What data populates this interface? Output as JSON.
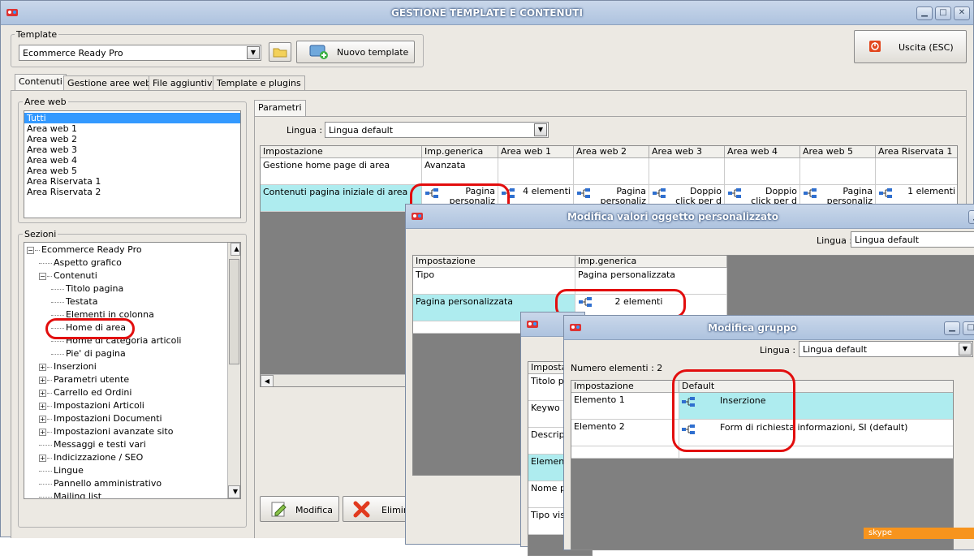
{
  "main": {
    "title": "GESTIONE TEMPLATE E CONTENUTI",
    "template_group_label": "Template",
    "template_value": "Ecommerce Ready Pro",
    "new_template_label": "Nuovo template",
    "exit_label": "Uscita (ESC)",
    "tabs": [
      "Contenuti",
      "Gestione aree web",
      "File aggiuntivi",
      "Template e plugins"
    ],
    "aree_label": "Aree web",
    "aree": [
      "Tutti",
      "Area web 1",
      "Area web 2",
      "Area web 3",
      "Area web 4",
      "Area web 5",
      "Area Riservata 1",
      "Area Riservata 2"
    ],
    "sezioni_label": "Sezioni",
    "tree": [
      {
        "t": "Ecommerce Ready Pro",
        "l": 0,
        "pm": "⊟"
      },
      {
        "t": "Aspetto grafico",
        "l": 1
      },
      {
        "t": "Contenuti",
        "l": 1,
        "pm": "⊟"
      },
      {
        "t": "Titolo pagina",
        "l": 2
      },
      {
        "t": "Testata",
        "l": 2
      },
      {
        "t": "Elementi in colonna",
        "l": 2
      },
      {
        "t": "Home di area",
        "l": 2
      },
      {
        "t": "Home di categoria articoli",
        "l": 2
      },
      {
        "t": "Pie' di pagina",
        "l": 2
      },
      {
        "t": "Inserzioni",
        "l": 1,
        "pm": "⊞"
      },
      {
        "t": "Parametri utente",
        "l": 1,
        "pm": "⊞"
      },
      {
        "t": "Carrello ed Ordini",
        "l": 1,
        "pm": "⊞"
      },
      {
        "t": "Impostazioni Articoli",
        "l": 1,
        "pm": "⊞"
      },
      {
        "t": "Impostazioni Documenti",
        "l": 1,
        "pm": "⊞"
      },
      {
        "t": "Impostazioni avanzate sito",
        "l": 1,
        "pm": "⊞"
      },
      {
        "t": "Messaggi e testi vari",
        "l": 1
      },
      {
        "t": "Indicizzazione / SEO",
        "l": 1,
        "pm": "⊞"
      },
      {
        "t": "Lingue",
        "l": 1
      },
      {
        "t": "Pannello amministrativo",
        "l": 1
      },
      {
        "t": "Mailing list",
        "l": 1
      }
    ],
    "parametri_tab": "Parametri",
    "lingua_label": "Lingua :",
    "lingua_value": "Lingua default",
    "grid_headers": [
      "Impostazione",
      "Imp.generica",
      "Area web 1",
      "Area web 2",
      "Area web 3",
      "Area web 4",
      "Area web 5",
      "Area Riservata 1"
    ],
    "row1": {
      "name": "Gestione home page di area",
      "generic": "Avanzata"
    },
    "row2": {
      "name": "Contenuti pagina iniziale di area",
      "cells": [
        "Pagina personaliz",
        "4 elementi",
        "Pagina personaliz",
        "Doppio click per d",
        "Doppio click per d",
        "Pagina personaliz",
        "1 elementi"
      ]
    },
    "modifica_label": "Modifica",
    "elimina_label": "Elimina"
  },
  "dialog1": {
    "title": "Modifica valori oggetto personalizzato",
    "lingua_label": "Lingua :",
    "lingua_value": "Lingua default",
    "headers": [
      "Impostazione",
      "Imp.generica"
    ],
    "rows": [
      [
        "Tipo",
        "Pagina personalizzata"
      ],
      [
        "Pagina personalizzata",
        "2 elementi"
      ]
    ]
  },
  "dialog2": {
    "rows": [
      "Imposta",
      "Titolo pa",
      "Keywo",
      "Descripti",
      "Elementi",
      "Nome pa",
      "Tipo visu"
    ]
  },
  "dialog3": {
    "title": "Modifica gruppo",
    "lingua_label": "Lingua :",
    "lingua_value": "Lingua default",
    "count_label": "Numero elementi : 2",
    "headers": [
      "Impostazione",
      "Default"
    ],
    "rows": [
      [
        "Elemento 1",
        "Inserzione"
      ],
      [
        "Elemento 2",
        "Form di richiesta informazioni, SI (default)"
      ]
    ]
  },
  "skype_label": "skype"
}
